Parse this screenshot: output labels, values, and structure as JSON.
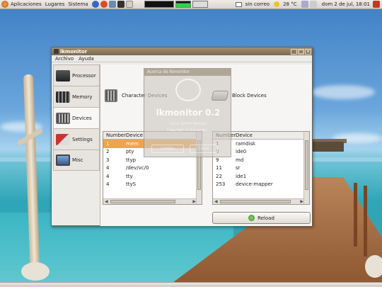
{
  "top_panel": {
    "menus": [
      "Aplicaciones",
      "Lugares",
      "Sistema"
    ],
    "mail_status": "sin correo",
    "weather": "28 °C",
    "datetime": "dom  2 de jul, 18:01"
  },
  "window": {
    "title": "lkmonitor",
    "menubar": [
      "Archivo",
      "Ayuda"
    ],
    "sidebar": [
      {
        "label": "Processor",
        "icon": "processor-icon"
      },
      {
        "label": "Memory",
        "icon": "memory-icon"
      },
      {
        "label": "Devices",
        "icon": "devices-icon",
        "active": true
      },
      {
        "label": "Settings",
        "icon": "settings-icon"
      },
      {
        "label": "Misc",
        "icon": "computer-icon"
      }
    ],
    "character_devices": {
      "heading": "Character Devices",
      "columns": [
        "Number",
        "Device"
      ],
      "rows": [
        {
          "number": "1",
          "device": "mem",
          "selected": true
        },
        {
          "number": "2",
          "device": "pty"
        },
        {
          "number": "3",
          "device": "ttyp"
        },
        {
          "number": "4",
          "device": "/dev/vc/0"
        },
        {
          "number": "4",
          "device": "tty"
        },
        {
          "number": "4",
          "device": "ttyS"
        }
      ]
    },
    "block_devices": {
      "heading": "Block Devices",
      "columns": [
        "Number",
        "Device"
      ],
      "rows": [
        {
          "number": "1",
          "device": "ramdisk"
        },
        {
          "number": "3",
          "device": "ide0"
        },
        {
          "number": "9",
          "device": "md"
        },
        {
          "number": "11",
          "device": "sr"
        },
        {
          "number": "22",
          "device": "ide1"
        },
        {
          "number": "253",
          "device": "device-mapper"
        }
      ]
    },
    "reload_label": "Reload"
  },
  "about_dialog": {
    "title": "Acerca de lkmonitor",
    "app_name": "lkmonitor 0.2",
    "subtitle": "Linux Kernel Monitor",
    "copyright": "Copyright © Fernando...",
    "btn_credits": "Créditos",
    "btn_close": "Cerrar"
  },
  "colors": {
    "selection": "#f0a44a",
    "titlebar": "#8c7858"
  }
}
